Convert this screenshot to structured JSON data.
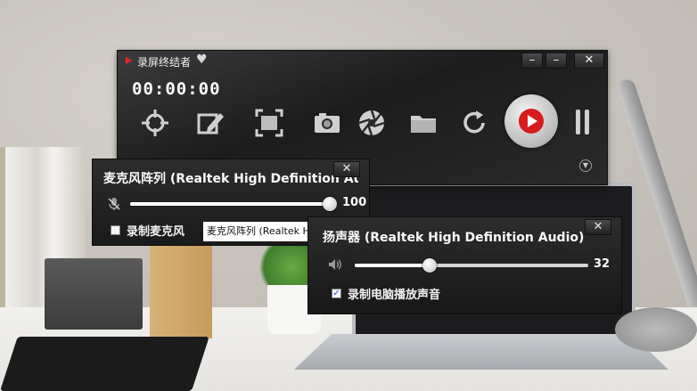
{
  "app": {
    "title": "录屏终结者",
    "timer": "00:00:00"
  },
  "window_buttons": {
    "minimize_to_tray": "–",
    "minimize": "–",
    "close": "✕"
  },
  "toolbar": {
    "tools": [
      {
        "name": "target-icon"
      },
      {
        "name": "edit-icon"
      },
      {
        "name": "region-icon"
      },
      {
        "name": "camera-icon"
      },
      {
        "name": "aperture-icon"
      },
      {
        "name": "folder-icon"
      },
      {
        "name": "refresh-icon"
      }
    ],
    "record": {
      "name": "record-button"
    },
    "pause": {
      "name": "pause-button"
    }
  },
  "microphone_panel": {
    "title": "麦克风阵列 (Realtek High Definition Au",
    "close": "✕",
    "volume": 100,
    "volume_label": "100",
    "record_checkbox_label": "录制麦克风",
    "record_checked": false,
    "device_select": "麦克风阵列 (Realtek High Definition Audio)"
  },
  "speaker_panel": {
    "title": "扬声器 (Realtek High Definition Audio)",
    "close": "✕",
    "volume": 32,
    "volume_label": "32",
    "record_checkbox_label": "录制电脑播放声音",
    "record_checked": true
  },
  "colors": {
    "record_red": "#d71b1b",
    "panel_bg": "#1f1f1f",
    "checkbox_blue": "#1a57c4"
  }
}
